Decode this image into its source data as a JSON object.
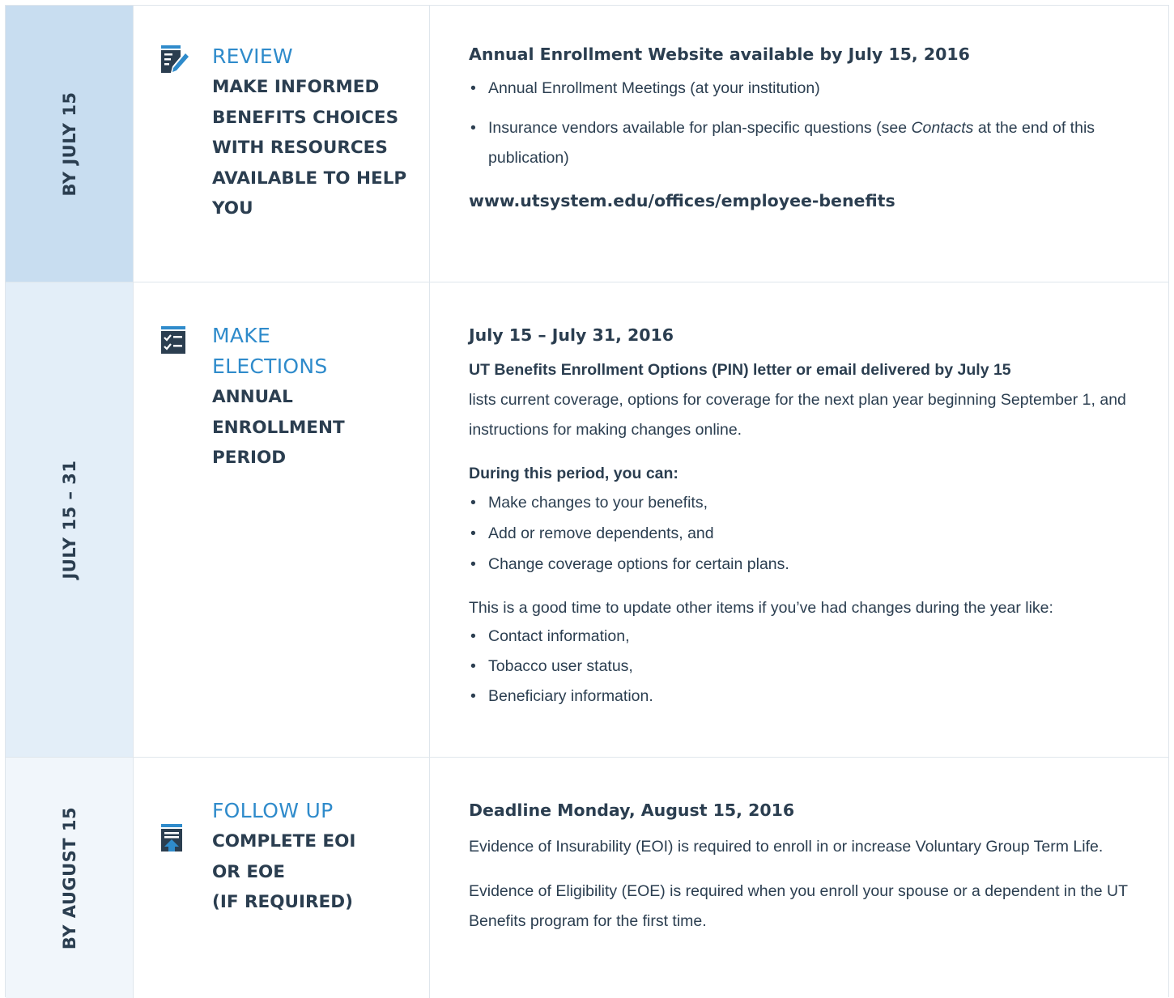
{
  "rows": [
    {
      "date": "BY JULY 15",
      "icon": "edit-document-icon",
      "title": "REVIEW",
      "subtitle": "MAKE INFORMED BENEFITS CHOICES WITH RESOURCES AVAILABLE TO HELP YOU",
      "heading": "Annual Enrollment Website available by July 15, 2016",
      "bullets": [
        "Annual Enrollment Meetings (at your institution)"
      ],
      "bullet2_pre": "Insurance vendors available for plan-specific questions (see ",
      "bullet2_em": "Contacts",
      "bullet2_post": " at the end of this publication)",
      "url": "www.utsystem.edu/offices/employee-benefits"
    },
    {
      "date": "JULY 15 – 31",
      "icon": "checklist-icon",
      "title_line1": "MAKE",
      "title_line2": "ELECTIONS",
      "subtitle": "ANNUAL ENROLLMENT PERIOD",
      "heading": "July 15 – July 31, 2016",
      "letter_bold": "UT Benefits Enrollment Options (PIN) letter or email delivered by July 15",
      "letter_text": "lists current coverage, options for coverage for the next plan year beginning September 1, and instructions for making changes online.",
      "period_heading": "During this period, you can:",
      "period_bullets": [
        "Make changes to your benefits,",
        "Add or remove dependents, and",
        "Change coverage options for certain plans."
      ],
      "update_text": "This is a good time to update other items if you’ve had changes during the year like:",
      "update_bullets": [
        "Contact information,",
        "Tobacco user status,",
        "Beneficiary information."
      ]
    },
    {
      "date": "BY AUGUST 15",
      "icon": "upload-document-icon",
      "title": "FOLLOW UP",
      "subtitle_lines": [
        "COMPLETE EOI",
        "OR EOE",
        "(IF REQUIRED)"
      ],
      "heading": "Deadline Monday, August 15, 2016",
      "p1": "Evidence of Insurability (EOI) is required to enroll in or increase Voluntary Group Term Life.",
      "p2": "Evidence of Eligibility (EOE) is required when you enroll your spouse or a dependent in the UT Benefits program for the first time."
    }
  ],
  "colors": {
    "accent": "#2f8bcb",
    "text": "#2b3e50",
    "date_col_1": "#c8ddf0",
    "date_col_2": "#e3eef8",
    "date_col_3": "#f1f6fb"
  }
}
